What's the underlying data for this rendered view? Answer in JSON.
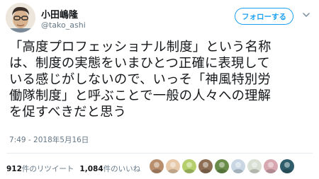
{
  "user": {
    "name": "小田嶋隆",
    "handle": "@tako_ashi"
  },
  "follow_button": {
    "label": "フォローする"
  },
  "tweet": {
    "lines": [
      "「高度プロフェッショナル制度」という名称",
      "は、制度の実態をいまひとつ正確に表現して",
      "いる感じがしないので、いっそ「神風特別労",
      "働隊制度」と呼ぶことで一般の人々への理解",
      "を促すべきだと思う"
    ]
  },
  "timestamp": "7:49 - 2018年5月16日",
  "stats": {
    "retweets_count": "912",
    "retweets_label": "件のリツイート",
    "likes_count": "1,084",
    "likes_label": "件のいいね"
  },
  "likers": [
    {
      "icon": "photo-avatar-icon",
      "color": "#b98e6d"
    },
    {
      "icon": "anime-avatar-icon",
      "color": "#e7c9a9"
    },
    {
      "icon": "leaf-avatar-icon",
      "color": "#b4cf6b"
    },
    {
      "icon": "cat-avatar-icon",
      "color": "#8d6e54"
    },
    {
      "icon": "moss-avatar-icon",
      "color": "#6a8c4a"
    },
    {
      "icon": "cup-avatar-icon",
      "color": "#c9d7e4"
    },
    {
      "icon": "bird-avatar-icon",
      "color": "#d9dfd3"
    },
    {
      "icon": "pink-avatar-icon",
      "color": "#d8a8b0"
    },
    {
      "icon": "landscape-avatar-icon",
      "color": "#2f5d6b"
    }
  ]
}
